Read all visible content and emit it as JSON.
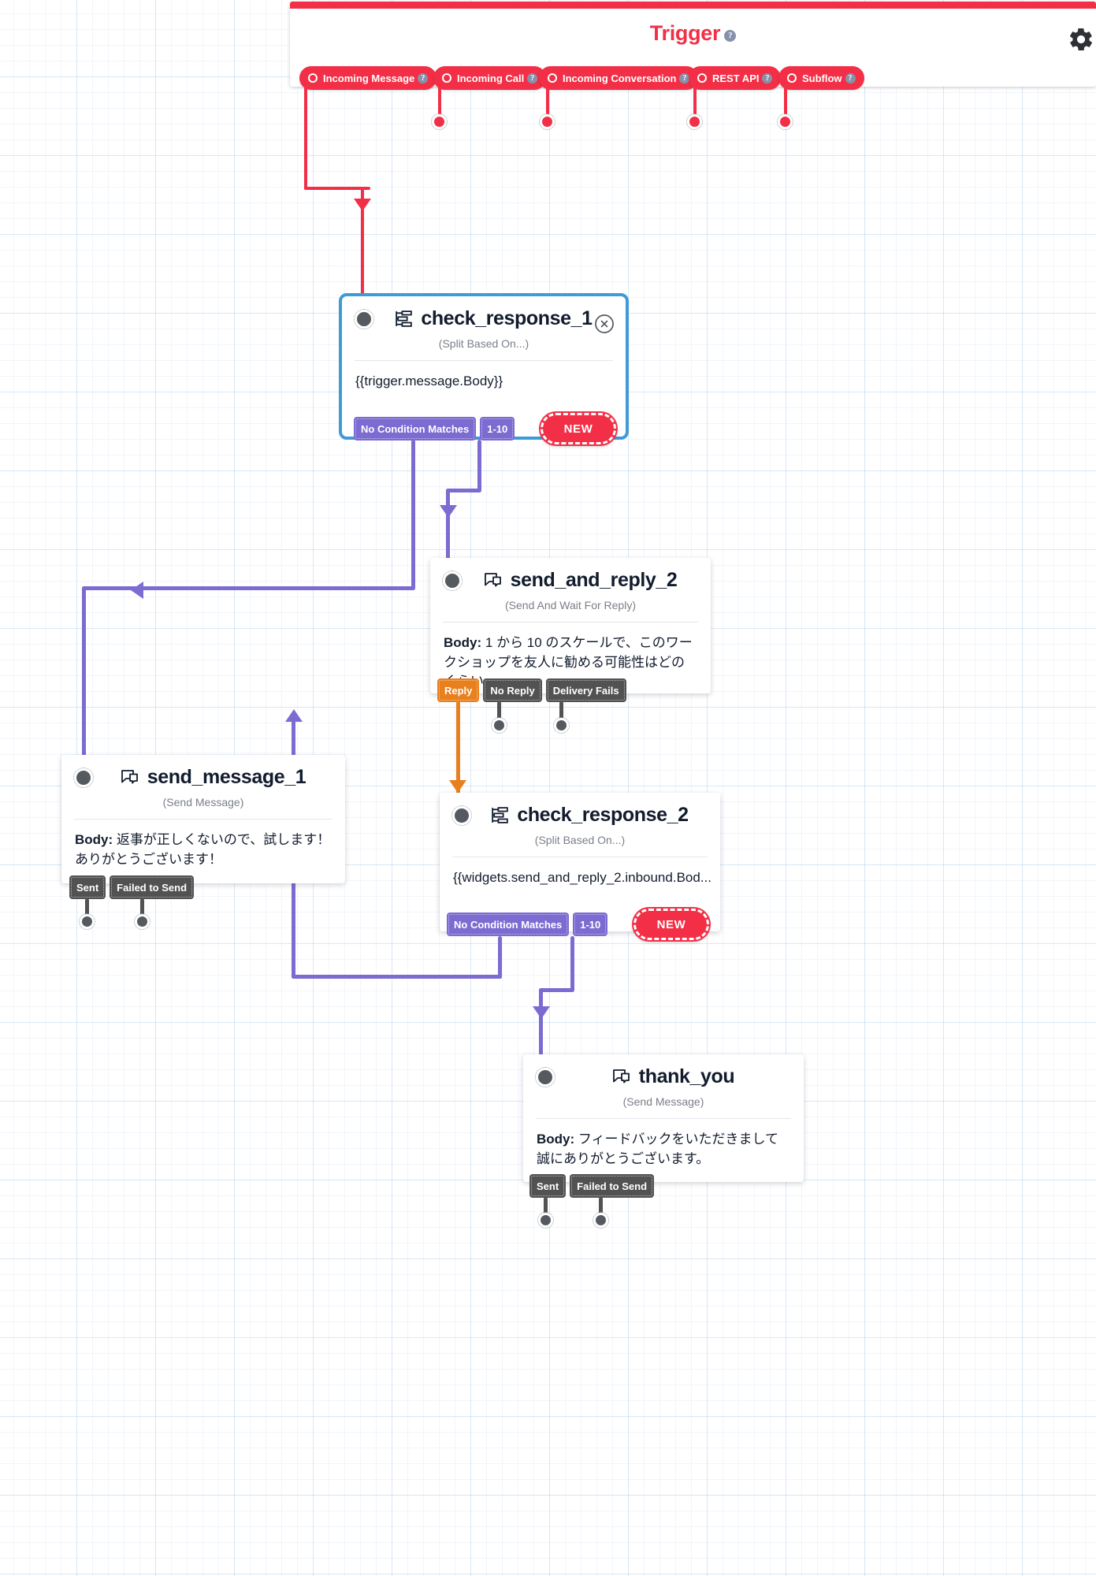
{
  "trigger": {
    "title": "Trigger",
    "help": "?",
    "gear_icon": "gear-icon",
    "pills": [
      {
        "label": "Incoming Message",
        "help": "?"
      },
      {
        "label": "Incoming Call",
        "help": "?"
      },
      {
        "label": "Incoming Conversation",
        "help": "?"
      },
      {
        "label": "REST API",
        "help": "?"
      },
      {
        "label": "Subflow",
        "help": "?"
      }
    ]
  },
  "nodes": {
    "check_response_1": {
      "title": "check_response_1",
      "subtitle": "(Split Based On...)",
      "body": "{{trigger.message.Body}}",
      "icon": "split-icon",
      "close_icon": "close-icon",
      "selected": true,
      "transitions": [
        {
          "label": "No Condition Matches",
          "color": "purple"
        },
        {
          "label": "1-10",
          "color": "purple"
        }
      ],
      "badge": "NEW"
    },
    "send_and_reply_2": {
      "title": "send_and_reply_2",
      "subtitle": "(Send And Wait For Reply)",
      "body_label": "Body:",
      "body": " 1 から 10 のスケールで、このワークショップを友人に勧める可能性はどのくらい",
      "icon": "message-bubble-icon",
      "transitions": [
        {
          "label": "Reply",
          "color": "orange"
        },
        {
          "label": "No Reply",
          "color": "gray"
        },
        {
          "label": "Delivery Fails",
          "color": "gray"
        }
      ]
    },
    "send_message_1": {
      "title": "send_message_1",
      "subtitle": "(Send Message)",
      "body_label": "Body:",
      "body": " 返事が正しくないので、試します！ありがとうございます！",
      "icon": "message-bubble-icon",
      "transitions": [
        {
          "label": "Sent",
          "color": "gray"
        },
        {
          "label": "Failed to Send",
          "color": "gray"
        }
      ]
    },
    "check_response_2": {
      "title": "check_response_2",
      "subtitle": "(Split Based On...)",
      "body": "{{widgets.send_and_reply_2.inbound.Bod...",
      "icon": "split-icon",
      "transitions": [
        {
          "label": "No Condition Matches",
          "color": "purple"
        },
        {
          "label": "1-10",
          "color": "purple"
        }
      ],
      "badge": "NEW"
    },
    "thank_you": {
      "title": "thank_you",
      "subtitle": "(Send Message)",
      "body_label": "Body:",
      "body": " フィードバックをいただきまして誠にありがとうございます。",
      "icon": "message-bubble-icon",
      "transitions": [
        {
          "label": "Sent",
          "color": "gray"
        },
        {
          "label": "Failed to Send",
          "color": "gray"
        }
      ]
    }
  },
  "colors": {
    "brand_red": "#f22f46",
    "purple": "#7c6bd1",
    "gray": "#525252",
    "orange": "#e8801e",
    "selection_blue": "#3f9ad8"
  }
}
